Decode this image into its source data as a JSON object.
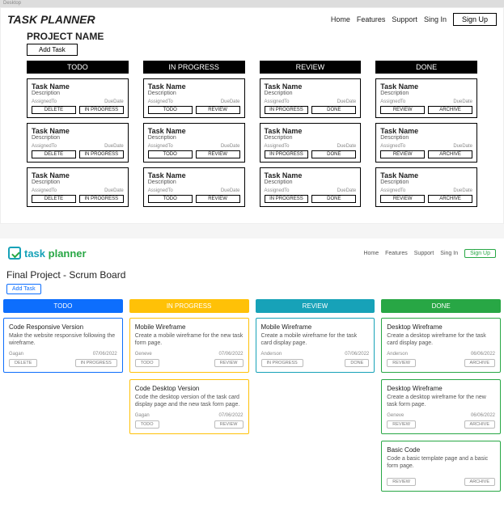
{
  "desktop_label": "Desktop",
  "wf": {
    "logo": "TASK PLANNER",
    "nav": {
      "home": "Home",
      "features": "Features",
      "support": "Support",
      "signin": "Sing In",
      "signup": "Sign Up"
    },
    "project_name": "PROJECT NAME",
    "add_task": "Add Task",
    "meta": {
      "assigned": "AssignedTo",
      "due": "DueDate"
    },
    "labels": {
      "task_name": "Task Name",
      "description": "Description"
    },
    "btn": {
      "delete": "DELETE",
      "todo": "TODO",
      "in_progress": "IN PROGRESS",
      "review": "REVIEW",
      "done": "DONE",
      "archive": "ARCHIVE"
    },
    "columns": [
      {
        "name": "TODO",
        "cards": 3,
        "left_btn": "DELETE",
        "right_btn": "IN PROGRESS"
      },
      {
        "name": "IN PROGRESS",
        "cards": 3,
        "left_btn": "TODO",
        "right_btn": "REVIEW"
      },
      {
        "name": "REVIEW",
        "cards": 3,
        "left_btn": "IN PROGRESS",
        "right_btn": "DONE"
      },
      {
        "name": "DONE",
        "cards": 3,
        "left_btn": "REVIEW",
        "right_btn": "ARCHIVE"
      }
    ]
  },
  "sb": {
    "logo_a": "task ",
    "logo_b": "planner",
    "nav": {
      "home": "Home",
      "features": "Features",
      "support": "Support",
      "signin": "Sing In",
      "signup": "Sign Up"
    },
    "title": "Final Project - Scrum Board",
    "add_task": "Add Task",
    "col_names": {
      "todo": "TODO",
      "prog": "IN PROGRESS",
      "rev": "REVIEW",
      "done": "DONE"
    },
    "btns": {
      "delete": "delete",
      "todo": "Todo",
      "in_progress": "In Progress",
      "review": "Review",
      "archive": "Archive"
    },
    "cards": {
      "todo": [
        {
          "title": "Code Responsive Version",
          "desc": "Make the website responsive following the wireframe.",
          "assignee": "Gagan",
          "date": "07/06/2022",
          "left": "delete",
          "right": "in_progress"
        }
      ],
      "prog": [
        {
          "title": "Mobile Wireframe",
          "desc": "Create a mobile wireframe for the new task form page.",
          "assignee": "Geneve",
          "date": "07/06/2022",
          "left": "todo",
          "right": "review"
        },
        {
          "title": "Code Desktop Version",
          "desc": "Code the desktop version of the task card display page and the new task form page.",
          "assignee": "Gagan",
          "date": "07/06/2022",
          "left": "todo",
          "right": "review"
        }
      ],
      "rev": [
        {
          "title": "Mobile Wireframe",
          "desc": "Create a mobile wireframe for the task card display page.",
          "assignee": "Anderson",
          "date": "07/06/2022",
          "left": "in_progress",
          "right": "done"
        }
      ],
      "done": [
        {
          "title": "Desktop Wireframe",
          "desc": "Create a desktop wireframe for the task card display page.",
          "assignee": "Anderson",
          "date": "06/06/2022",
          "left": "review",
          "right": "archive"
        },
        {
          "title": "Desktop Wireframe",
          "desc": "Create a desktop wireframe for the new task form page.",
          "assignee": "Geneve",
          "date": "06/06/2022",
          "left": "review",
          "right": "archive"
        },
        {
          "title": "Basic Code",
          "desc": "Code a basic template page and a basic form page.",
          "assignee": "",
          "date": "",
          "left": "review",
          "right": "archive"
        }
      ]
    }
  }
}
